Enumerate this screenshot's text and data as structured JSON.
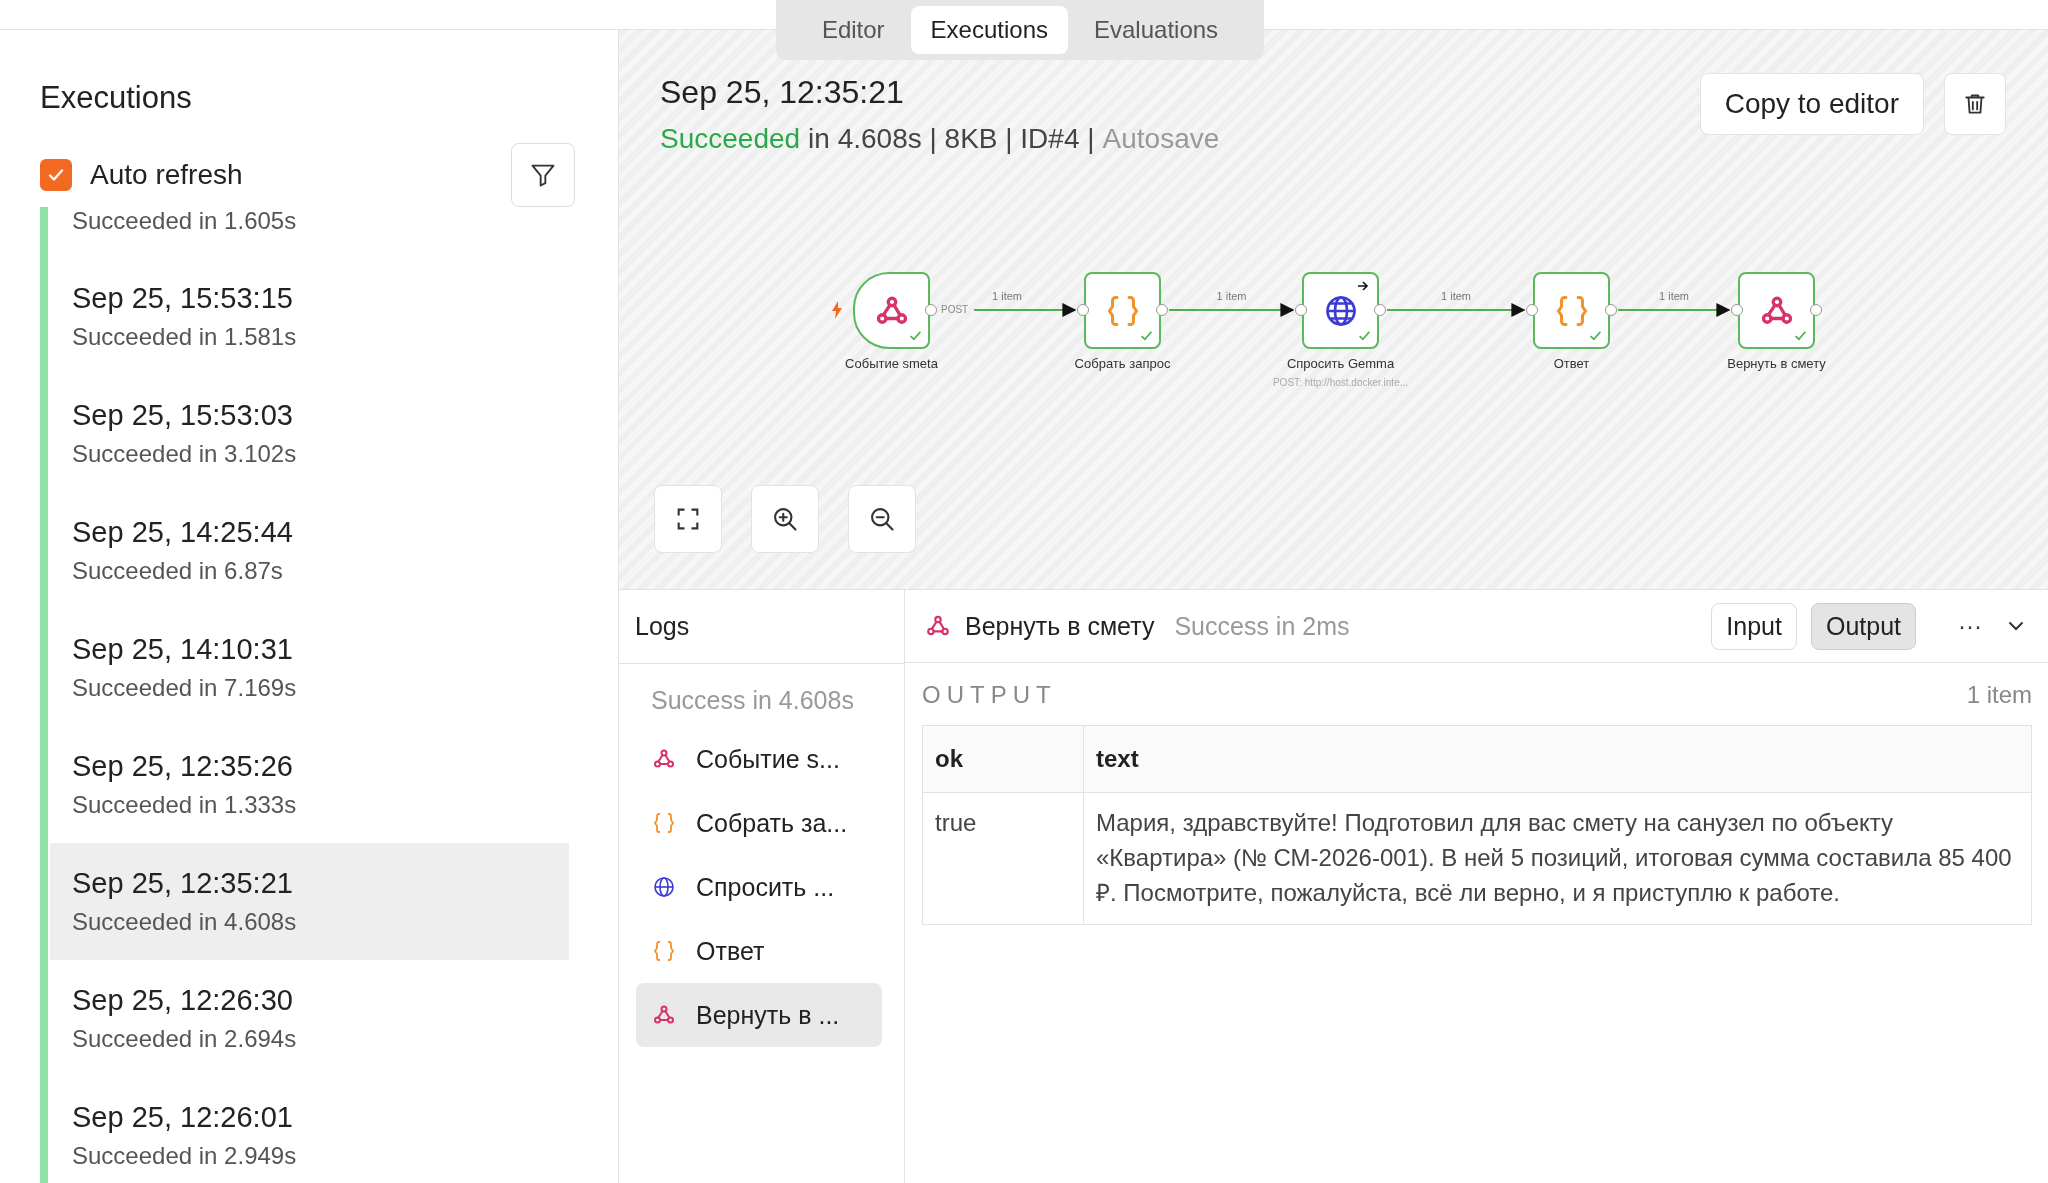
{
  "tabs": [
    {
      "label": "Editor",
      "selected": false
    },
    {
      "label": "Executions",
      "selected": true
    },
    {
      "label": "Evaluations",
      "selected": false
    }
  ],
  "sidebar": {
    "title": "Executions",
    "auto_refresh": {
      "label": "Auto refresh",
      "checked": true
    },
    "executions": [
      {
        "status": "Succeeded in 1.605s",
        "selected": false
      },
      {
        "date": "Sep 25, 15:53:15",
        "status": "Succeeded in 1.581s",
        "selected": false
      },
      {
        "date": "Sep 25, 15:53:03",
        "status": "Succeeded in 3.102s",
        "selected": false
      },
      {
        "date": "Sep 25, 14:25:44",
        "status": "Succeeded in 6.87s",
        "selected": false
      },
      {
        "date": "Sep 25, 14:10:31",
        "status": "Succeeded in 7.169s",
        "selected": false
      },
      {
        "date": "Sep 25, 12:35:26",
        "status": "Succeeded in 1.333s",
        "selected": false
      },
      {
        "date": "Sep 25, 12:35:21",
        "status": "Succeeded in 4.608s",
        "selected": true
      },
      {
        "date": "Sep 25, 12:26:30",
        "status": "Succeeded in 2.694s",
        "selected": false
      },
      {
        "date": "Sep 25, 12:26:01",
        "status": "Succeeded in 2.949s",
        "selected": false
      }
    ]
  },
  "execution": {
    "date": "Sep 25, 12:35:21",
    "status": "Succeeded",
    "summary": "in 4.608s | 8KB | ID#4 |",
    "mode": "Autosave",
    "copy_button": "Copy to editor"
  },
  "workflow": {
    "nodes": [
      {
        "name": "Событие smeta",
        "kind": "webhook",
        "trigger": true,
        "success": true
      },
      {
        "name": "Собрать запрос",
        "kind": "code",
        "trigger": false,
        "success": true
      },
      {
        "name": "Спросить Gemma",
        "kind": "http",
        "subtitle": "POST: http://host.docker.inte...",
        "trigger": false,
        "success": true
      },
      {
        "name": "Ответ",
        "kind": "code",
        "trigger": false,
        "success": true
      },
      {
        "name": "Вернуть в смету",
        "kind": "webhook",
        "trigger": false,
        "success": true
      }
    ],
    "edges": [
      {
        "label": "1 item",
        "output_label": "POST"
      },
      {
        "label": "1 item"
      },
      {
        "label": "1 item"
      },
      {
        "label": "1 item"
      }
    ]
  },
  "logs": {
    "title": "Logs",
    "summary": "Success in 4.608s",
    "entries": [
      {
        "name": "Событие s...",
        "kind": "webhook",
        "selected": false
      },
      {
        "name": "Собрать за...",
        "kind": "code",
        "selected": false
      },
      {
        "name": "Спросить ...",
        "kind": "http",
        "selected": false
      },
      {
        "name": "Ответ",
        "kind": "code",
        "selected": false
      },
      {
        "name": "Вернуть в ...",
        "kind": "webhook",
        "selected": true
      }
    ]
  },
  "output_panel": {
    "node": {
      "name": "Вернуть в смету",
      "kind": "webhook"
    },
    "status": "Success in 2ms",
    "views": [
      {
        "label": "Input",
        "selected": false
      },
      {
        "label": "Output",
        "selected": true
      }
    ],
    "more": "···",
    "section": "OUTPUT",
    "count": "1 item",
    "table": {
      "columns": [
        "ok",
        "text"
      ],
      "rows": [
        [
          "true",
          "Мария, здравствуйте! Подготовил для вас смету на санузел по объекту «Квартира» (№ СМ-2026-001). В ней 5 позиций, итоговая сумма составила 85 400 ₽. Посмотрите, пожалуйста, всё ли верно, и я приступлю к работе."
        ]
      ]
    }
  }
}
